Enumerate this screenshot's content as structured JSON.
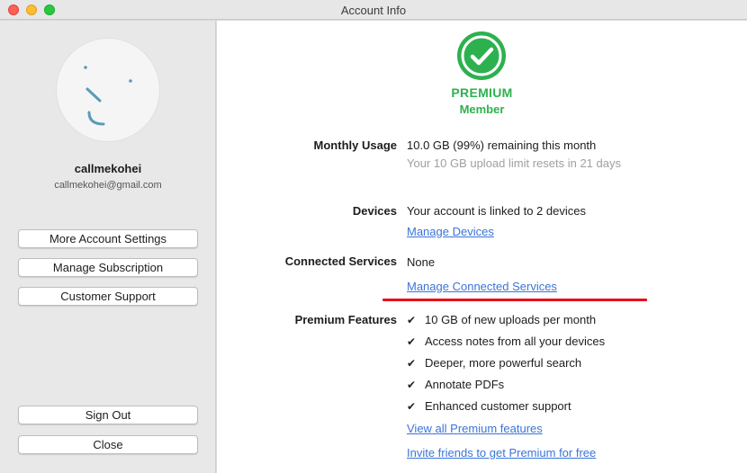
{
  "window": {
    "title": "Account Info"
  },
  "colors": {
    "premium_green": "#2db14f",
    "link_blue": "#3b74d9",
    "annotation_red": "#e8101a"
  },
  "user": {
    "username": "callmekohei",
    "email": "callmekohei@gmail.com"
  },
  "sidebar_buttons": {
    "more_settings": "More Account Settings",
    "manage_subscription": "Manage Subscription",
    "customer_support": "Customer Support",
    "sign_out": "Sign Out",
    "close": "Close"
  },
  "plan": {
    "tier": "PREMIUM",
    "subtitle": "Member",
    "icon": "checkmark-circle-icon"
  },
  "monthly_usage": {
    "label": "Monthly Usage",
    "value": "10.0 GB (99%) remaining this month",
    "note": "Your 10 GB upload limit resets in 21 days"
  },
  "devices": {
    "label": "Devices",
    "value": "Your account is linked to 2 devices",
    "link": "Manage Devices"
  },
  "connected_services": {
    "label": "Connected Services",
    "value": "None",
    "link": "Manage Connected Services"
  },
  "premium_features": {
    "label": "Premium Features",
    "items": [
      "10 GB of new uploads per month",
      "Access notes from all your devices",
      "Deeper, more powerful search",
      "Annotate PDFs",
      "Enhanced customer support"
    ],
    "view_all_link": "View all Premium features",
    "invite_link": "Invite friends to get Premium for free"
  }
}
